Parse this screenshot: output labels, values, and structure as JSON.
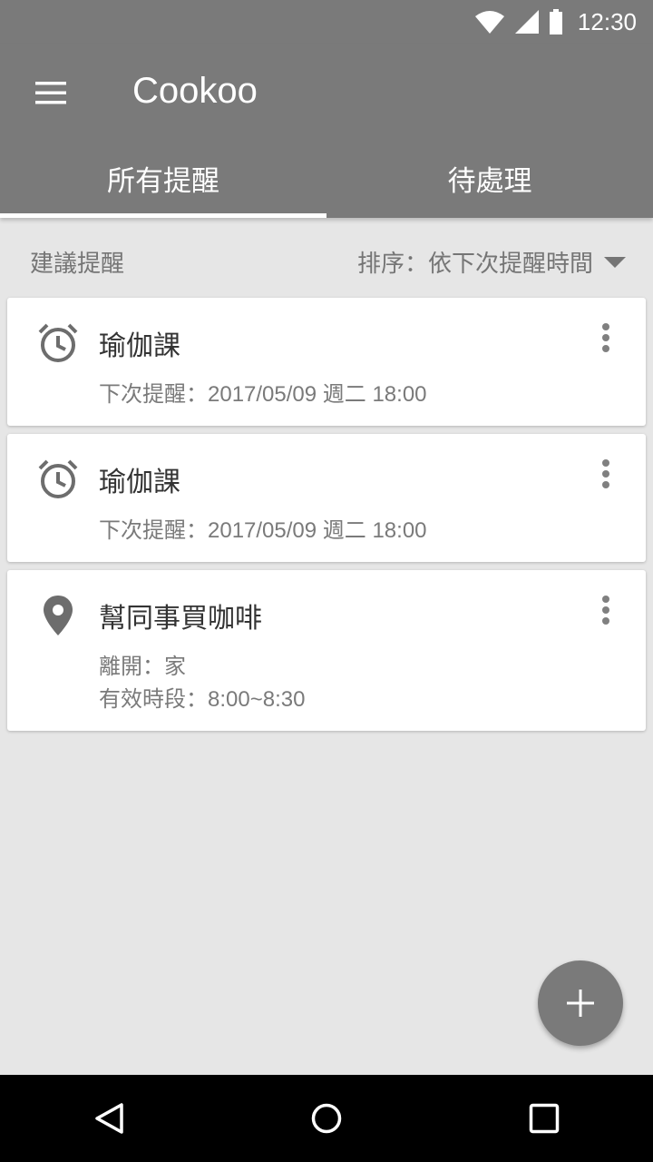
{
  "status_bar": {
    "time": "12:30",
    "icons": [
      "wifi-icon",
      "signal-icon",
      "battery-icon"
    ]
  },
  "app_bar": {
    "title": "Cookoo",
    "menu_icon": "hamburger-menu-icon"
  },
  "tabs": [
    {
      "label": "所有提醒",
      "active": true
    },
    {
      "label": "待處理",
      "active": false
    }
  ],
  "subheader": {
    "left_label": "建議提醒",
    "sort_label": "排序：依下次提醒時間",
    "sort_icon": "dropdown-arrow-icon"
  },
  "reminders": [
    {
      "icon": "alarm-clock-icon",
      "title": "瑜伽課",
      "line1": "下次提醒：2017/05/09 週二 18:00"
    },
    {
      "icon": "alarm-clock-icon",
      "title": "瑜伽課",
      "line1": "下次提醒：2017/05/09 週二 18:00"
    },
    {
      "icon": "location-pin-icon",
      "title": "幫同事買咖啡",
      "line1": "離開：家",
      "line2": "有效時段：8:00~8:30"
    }
  ],
  "fab": {
    "icon": "plus-icon"
  },
  "nav_bar": {
    "icons": [
      "back-icon",
      "home-icon",
      "recents-icon"
    ]
  },
  "colors": {
    "primary": "#7a7a7a",
    "background": "#e6e6e6",
    "card": "#ffffff",
    "text_secondary": "#7a7a7a"
  }
}
